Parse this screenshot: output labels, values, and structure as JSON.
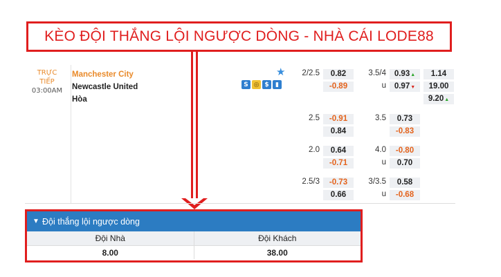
{
  "banner_title": "KÈO ĐỘI THẮNG LỘI NGƯỢC DÒNG - NHÀ CÁI LODE88",
  "match": {
    "status_line1": "TRỰC",
    "status_line2": "TIẾP",
    "time": "03:00AM",
    "home": "Manchester City",
    "away": "Newcastle United",
    "draw": "Hòa"
  },
  "icons": [
    "s-icon",
    "coin-icon",
    "dollar-icon",
    "chart-icon"
  ],
  "odds_rows": [
    {
      "hdp": "2/2.5",
      "h1": "0.82",
      "h2": "-0.89",
      "ou": "3.5/4",
      "ou_u": "u",
      "o1": "0.93",
      "o2": "0.97",
      "x1": "1.14",
      "x2": "19.00",
      "x3": "9.20"
    },
    {
      "hdp": "2.5",
      "h1": "-0.91",
      "h2": "0.84",
      "ou": "3.5",
      "o1": "0.73",
      "o2": "-0.83"
    },
    {
      "hdp": "2.0",
      "h1": "0.64",
      "h2": "-0.71",
      "ou": "4.0",
      "ou_u": "u",
      "o1": "-0.80",
      "o2": "0.70"
    },
    {
      "hdp": "2.5/3",
      "h1": "-0.73",
      "h2": "0.66",
      "ou": "3/3.5",
      "ou_u": "u",
      "o1": "0.58",
      "o2": "-0.68"
    }
  ],
  "panel": {
    "title": "Đội thắng lội ngược dòng",
    "col_home": "Đội Nhà",
    "col_away": "Đội Khách",
    "val_home": "8.00",
    "val_away": "38.00"
  },
  "colors": {
    "accent_red": "#e01e1e",
    "header_blue": "#2c7cc2",
    "orange": "#e98a2a"
  }
}
